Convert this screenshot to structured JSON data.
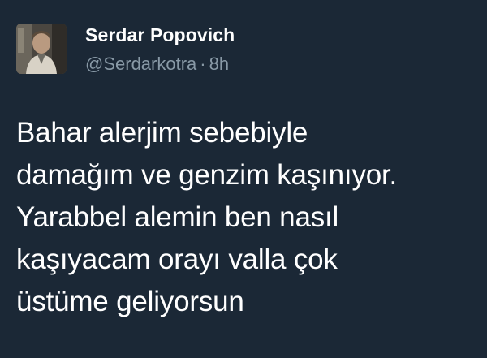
{
  "user": {
    "display_name": "Serdar Popovich",
    "handle": "@Serdarkotra",
    "separator": "·",
    "time_ago": "8h",
    "avatar_icon": "profile-photo-man"
  },
  "tweet": {
    "lines": [
      "Bahar alerjim sebebiyle",
      "damağım ve genzim kaşınıyor.",
      "Yarabbel alemin ben nasıl",
      "kaşıyacam orayı valla çok",
      "üstüme geliyorsun"
    ]
  },
  "colors": {
    "background": "#1b2836",
    "primary_text": "#ffffff",
    "secondary_text": "#8899a6"
  }
}
